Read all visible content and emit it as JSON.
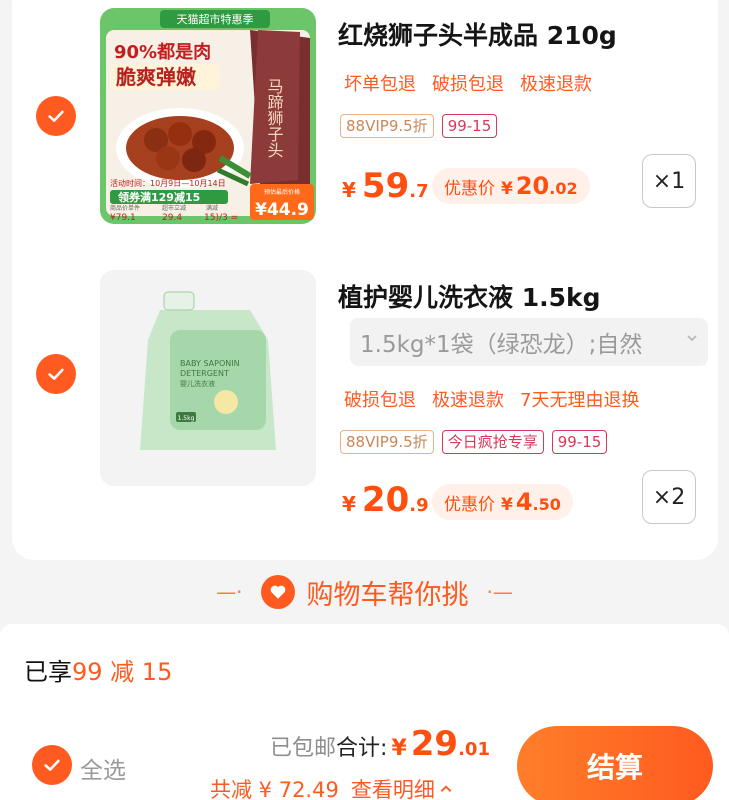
{
  "cart": {
    "items": [
      {
        "title": "红烧狮子头半成品 210g",
        "tags": [
          "坏单包退",
          "破损包退",
          "极速退款"
        ],
        "badges": [
          "88VIP9.5折",
          "99-15"
        ],
        "price_yen": "¥",
        "price_int": "59",
        "price_dec": ".7",
        "promo_label": "优惠价",
        "promo_yen": "¥",
        "promo_int": "20",
        "promo_dec": ".02",
        "qty": "×1",
        "image": {
          "banner": "天猫超市特惠季",
          "headline1": "90%都是肉",
          "headline2": "脆爽弹嫩",
          "bag_text": "马蹄狮子头",
          "event": "活动时间：10月9日—10月14日",
          "coupon": "领券满129减15",
          "final_label": "预估最后价格",
          "final_price": "¥44.9",
          "row1_label1": "商品价单件",
          "row1_label2": "超市立减",
          "row1_label3": "满减",
          "row2_val1": "¥79.1",
          "row2_val2": "29.4",
          "row2_val3": "15)/3 ="
        }
      },
      {
        "title": "植护婴儿洗衣液 1.5kg",
        "sku": "1.5kg*1袋（绿恐龙）;自然",
        "tags": [
          "破损包退",
          "极速退款",
          "7天无理由退换"
        ],
        "badges": [
          "88VIP9.5折",
          "今日疯抢专享",
          "99-15"
        ],
        "price_yen": "¥",
        "price_int": "20",
        "price_dec": ".9",
        "promo_label": "优惠价",
        "promo_yen": "¥",
        "promo_int": "4",
        "promo_dec": ".50",
        "qty": "×2",
        "image": {
          "label1": "BABY SAPONIN",
          "label2": "DETERGENT",
          "label3": "婴儿洗衣液",
          "size": "1.5kg"
        }
      }
    ]
  },
  "helper": {
    "left": "—·",
    "text": "购物车帮你挑",
    "right": "·—"
  },
  "footer": {
    "enjoy_prefix": "已享",
    "enjoy_value": "99 减 15",
    "select_all": "全选",
    "shipped": "已包邮",
    "total_label": "合计:",
    "total_yen": "¥",
    "total_int": "29",
    "total_dec": ".01",
    "saved_text": "共减 ¥ 72.49",
    "detail": "查看明细",
    "detail_caret": "^",
    "checkout": "结算"
  },
  "colors": {
    "accent": "#ff5a1f",
    "price": "#ff4f0f",
    "badge_red": "#d8385a",
    "vip": "#c9885a"
  },
  "icons": [
    "check-circle-icon",
    "heart-icon",
    "chevron-down-icon",
    "caret-up-icon"
  ]
}
